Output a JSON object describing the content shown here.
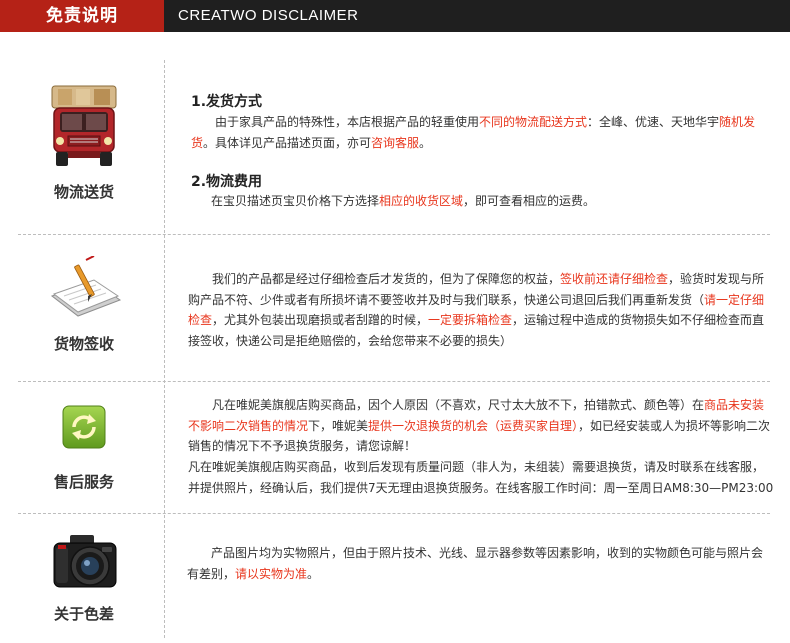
{
  "header": {
    "tab_label": "免责说明",
    "title": "CREATWO DISCLAIMER"
  },
  "sections": {
    "shipping": {
      "label": "物流送货",
      "icon": "truck-icon",
      "heading1": "1.发货方式",
      "p1": {
        "a": "由于家具产品的特殊性，本店根据产品的轻重使用",
        "b": "不同的物流配送方式",
        "c": "：全峰、优速、天地华宇",
        "d": "随机发货",
        "e": "。具体详见产品描述页面，亦可",
        "f": "咨询客服",
        "g": "。"
      },
      "heading2": "2.物流费用",
      "p2": {
        "a": "在宝贝描述页宝贝价格下方选择",
        "b": "相应的收货区域",
        "c": "，即可查看相应的运费。"
      }
    },
    "signing": {
      "label": "货物签收",
      "icon": "document-pen-icon",
      "p": {
        "a": "我们的产品都是经过仔细检查后才发货的，但为了保障您的权益，",
        "b": "签收前还请仔细检查",
        "c": "，验货时发现与所购产品不符、少件或者有所损坏请不要签收并及时与我们联系，快递公司退回后我们再重新发货（",
        "d": "请一定仔细检查",
        "e": "，尤其外包装出现磨损或者刮蹭的时候，",
        "f": "一定要拆箱检查",
        "g": "，运输过程中造成的货物损失如不仔细检查而直接签收，快递公司是拒绝赔偿的，会给您带来不必要的损失）"
      }
    },
    "aftersales": {
      "label": "售后服务",
      "icon": "refresh-icon",
      "p1": {
        "a": "凡在唯妮美旗舰店购买商品，因个人原因（不喜欢，尺寸太大放不下，拍错款式、颜色等）在",
        "b": "商品未安装不影响二次销售的情况",
        "c": "下，唯妮美",
        "d": "提供一次退换货的机会（运费买家自理）",
        "e": "，如已经安装或人为损坏等影响二次销售的情况下不予退换货服务，请您谅解！"
      },
      "p2": "凡在唯妮美旗舰店购买商品，收到后发现有质量问题（非人为，未组装）需要退换货，请及时联系在线客服，并提供照片，经确认后，我们提供7天无理由退换货服务。在线客服工作时间：周一至周日AM8:30—PM23:00"
    },
    "color": {
      "label": "关于色差",
      "icon": "camera-icon",
      "p": {
        "a": "产品图片均为实物照片，但由于照片技术、光线、显示器参数等因素影响，收到的实物颜色可能与照片会有差别，",
        "b": "请以实物为准",
        "c": "。"
      }
    }
  },
  "colors": {
    "accent": "#e8361d",
    "header_red": "#b52217",
    "header_dark": "#1f1f1f",
    "icon_green": "#7cb82f"
  }
}
